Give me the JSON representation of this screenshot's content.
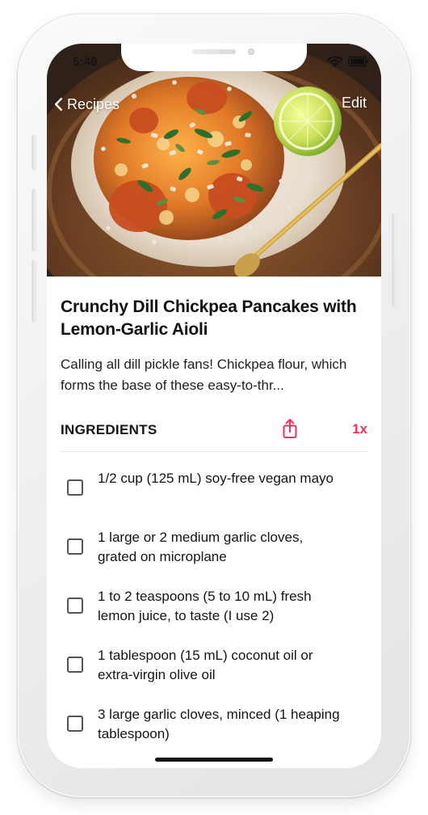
{
  "status_bar": {
    "time": "5:49",
    "wifi_icon": "wifi-icon",
    "battery_icon": "battery-icon"
  },
  "navigation": {
    "back_label": "Recipes",
    "edit_label": "Edit",
    "back_icon": "chevron-left-icon"
  },
  "recipe": {
    "title": "Crunchy Dill Chickpea Pancakes with Lemon-Garlic Aioli",
    "description": "Calling all dill pickle fans! Chickpea flour, which forms the base of these easy-to-thr..."
  },
  "ingredients_section": {
    "title": "INGREDIENTS",
    "share_icon": "share-icon",
    "scale_label": "1x",
    "accent_color": "#F2315E",
    "items": [
      {
        "text": "1/2 cup (125 mL) soy-free vegan mayo"
      },
      {
        "text": "1 large or 2 medium garlic cloves, grated on microplane"
      },
      {
        "text": "1 to 2 teaspoons (5 to 10 mL) fresh lemon juice, to taste (I use 2)"
      },
      {
        "text": "1 tablespoon (15 mL) coconut oil or extra-virgin olive oil"
      },
      {
        "text": "3 large garlic cloves, minced (1 heaping tablespoon)"
      }
    ]
  }
}
